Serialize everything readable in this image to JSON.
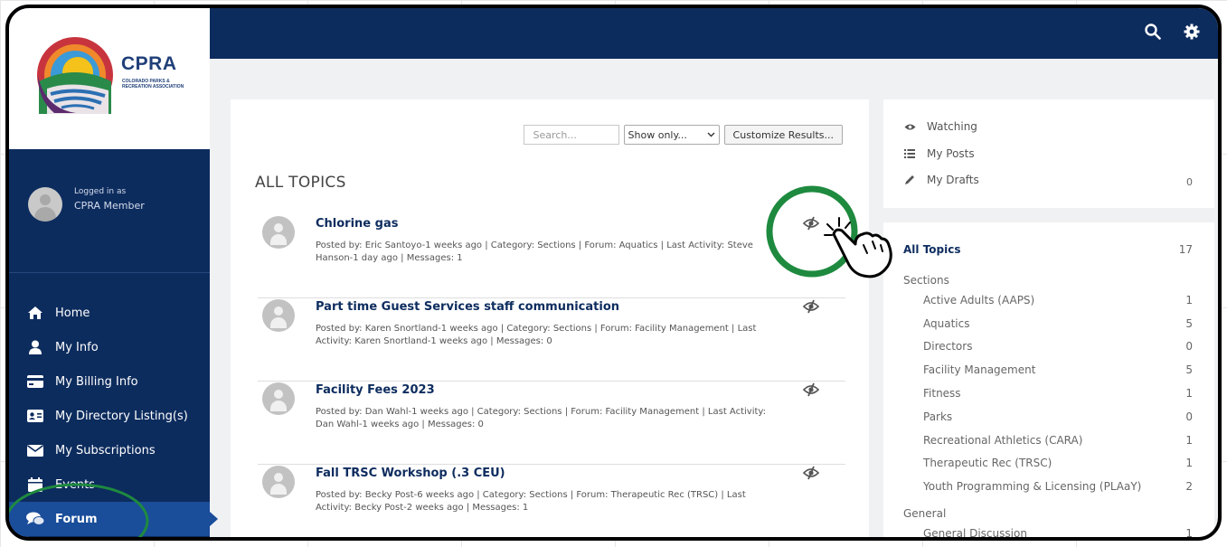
{
  "logo": {
    "name": "CPRA",
    "subtitle": "COLORADO PARKS & RECREATION ASSOCIATION"
  },
  "user": {
    "logged_label": "Logged in as",
    "name": "CPRA Member"
  },
  "nav": [
    {
      "label": "Home",
      "icon": "home-icon"
    },
    {
      "label": "My Info",
      "icon": "user-icon"
    },
    {
      "label": "My Billing Info",
      "icon": "credit-card-icon"
    },
    {
      "label": "My Directory Listing(s)",
      "icon": "id-card-icon"
    },
    {
      "label": "My Subscriptions",
      "icon": "envelope-icon"
    },
    {
      "label": "Events",
      "icon": "calendar-icon"
    },
    {
      "label": "Forum",
      "icon": "comments-icon"
    }
  ],
  "toolbar": {
    "search_placeholder": "Search...",
    "filter_selected": "Show only...",
    "customize_label": "Customize Results..."
  },
  "section_title": "ALL TOPICS",
  "topics": [
    {
      "title": "Chlorine gas",
      "meta": "Posted by: Eric Santoyo-1 weeks ago | Category: Sections | Forum: Aquatics | Last Activity: Steve Hanson-1 day ago | Messages: 1"
    },
    {
      "title": "Part time Guest Services staff communication",
      "meta": "Posted by: Karen Snortland-1 weeks ago | Category: Sections | Forum: Facility Management | Last Activity: Karen Snortland-1 weeks ago | Messages: 0"
    },
    {
      "title": "Facility Fees 2023",
      "meta": "Posted by: Dan Wahl-1 weeks ago | Category: Sections | Forum: Facility Management | Last Activity: Dan Wahl-1 weeks ago | Messages: 0"
    },
    {
      "title": "Fall TRSC Workshop (.3 CEU)",
      "meta": "Posted by: Becky Post-6 weeks ago | Category: Sections | Forum: Therapeutic Rec (TRSC) | Last Activity: Becky Post-2 weeks ago | Messages: 1"
    }
  ],
  "quick_links": {
    "watching": "Watching",
    "my_posts": "My Posts",
    "my_drafts": "My Drafts",
    "drafts_count": "0"
  },
  "categories": {
    "all_label": "All Topics",
    "all_count": "17",
    "sections_label": "Sections",
    "sections": [
      {
        "name": "Active Adults (AAPS)",
        "count": "1"
      },
      {
        "name": "Aquatics",
        "count": "5"
      },
      {
        "name": "Directors",
        "count": "0"
      },
      {
        "name": "Facility Management",
        "count": "5"
      },
      {
        "name": "Fitness",
        "count": "1"
      },
      {
        "name": "Parks",
        "count": "0"
      },
      {
        "name": "Recreational Athletics (CARA)",
        "count": "1"
      },
      {
        "name": "Therapeutic Rec (TRSC)",
        "count": "1"
      },
      {
        "name": "Youth Programming & Licensing (PLAaY)",
        "count": "2"
      }
    ],
    "general_label": "General",
    "general": [
      {
        "name": "General Discussion",
        "count": "1"
      }
    ]
  },
  "colors": {
    "navy": "#0d2c5e",
    "active_nav": "#1a4d9a",
    "highlight_circle": "#1e8a3f"
  }
}
